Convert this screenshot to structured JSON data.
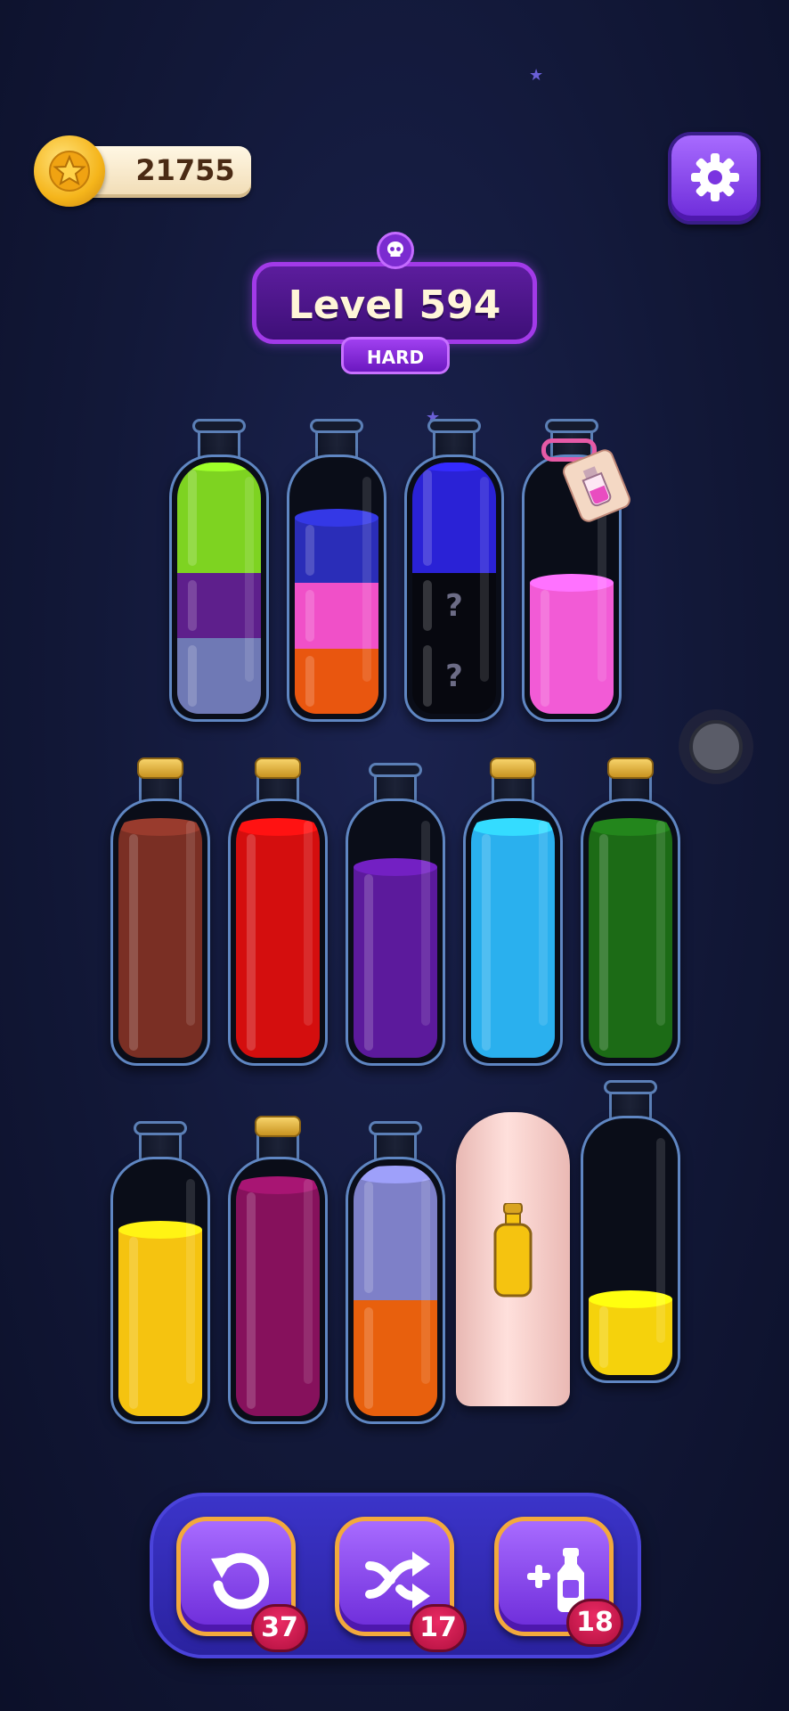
{
  "coins": {
    "value": "21755",
    "icon": "star-coin-icon"
  },
  "settings": {
    "icon": "gear-icon"
  },
  "level": {
    "title": "Level 594",
    "difficulty": "HARD",
    "icon": "skull-icon"
  },
  "bottles": {
    "row1": [
      {
        "layers": [
          "#6f79b5",
          "#5e1f8c",
          "#7ed321"
        ],
        "capped": false
      },
      {
        "layers": [
          "#e9560f",
          "#f050c8",
          "#2a2db8"
        ],
        "capped": false
      },
      {
        "layers": [
          "hidden",
          "hidden",
          "#2a22d6"
        ],
        "hidden_mark": "?",
        "capped": false
      },
      {
        "layers": [
          "#f25bd6"
        ],
        "capped": false,
        "locked": true
      }
    ],
    "row2": [
      {
        "layers": [
          "#7a2f24"
        ],
        "capped": true
      },
      {
        "layers": [
          "#d40e0e"
        ],
        "capped": true
      },
      {
        "layers": [
          "#5c1a9c"
        ],
        "capped": false
      },
      {
        "layers": [
          "#2ab0ee"
        ],
        "capped": true
      },
      {
        "layers": [
          "#1c6b16"
        ],
        "capped": true
      }
    ],
    "row3": [
      {
        "layers": [
          "#f5c310"
        ],
        "capped": false
      },
      {
        "layers": [
          "#86115c"
        ],
        "capped": true
      },
      {
        "layers": [
          "#e8600d",
          "#7e80c8"
        ],
        "capped": false
      },
      {
        "covered": true,
        "hint_color": "#f5c310"
      },
      {
        "layers": [
          "#f5d20c"
        ],
        "capped": false
      }
    ]
  },
  "tools": [
    {
      "name": "undo",
      "icon": "undo-icon",
      "count": "37"
    },
    {
      "name": "shuffle",
      "icon": "shuffle-icon",
      "count": "17"
    },
    {
      "name": "add-bottle",
      "icon": "add-bottle-icon",
      "count": "18"
    }
  ],
  "colors": {
    "accent": "#7b2bd0",
    "badge": "#d01a4d",
    "button_border": "#f3a93c"
  }
}
